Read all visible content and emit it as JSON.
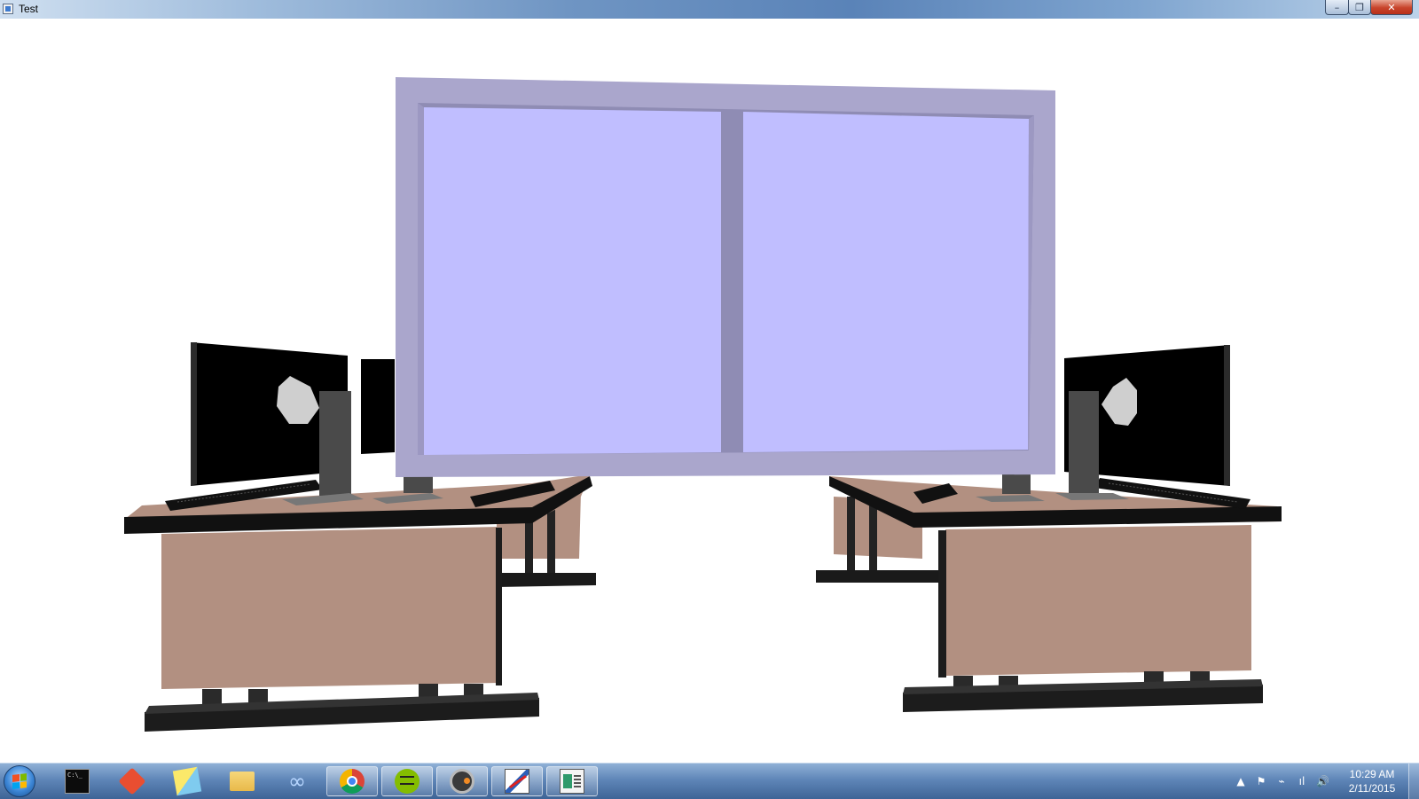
{
  "window": {
    "title": "Test",
    "controls": {
      "minimize": "–",
      "maximize": "❐",
      "close": "✕"
    }
  },
  "scene": {
    "description_colors": {
      "board_frame": "#aaa6cc",
      "board_panel": "#c0beff",
      "desk_top": "#b29081",
      "desk_edge": "#111111",
      "monitor": "#000000",
      "monitor_stand": "#4a4a4a",
      "logo": "#cfcfcf"
    }
  },
  "taskbar": {
    "items": [
      {
        "name": "command-prompt",
        "label": "C:\\_"
      },
      {
        "name": "git"
      },
      {
        "name": "sticky-notes"
      },
      {
        "name": "file-explorer"
      },
      {
        "name": "visual-studio",
        "label": "∞"
      },
      {
        "name": "chrome"
      },
      {
        "name": "spotify"
      },
      {
        "name": "app-c"
      },
      {
        "name": "paint"
      },
      {
        "name": "test-app"
      }
    ],
    "tray": {
      "arrow": "▲",
      "flag": "⚑",
      "power": "⌁",
      "network": "ıl",
      "volume": "🔊"
    },
    "clock": {
      "time": "10:29 AM",
      "date": "2/11/2015"
    }
  }
}
